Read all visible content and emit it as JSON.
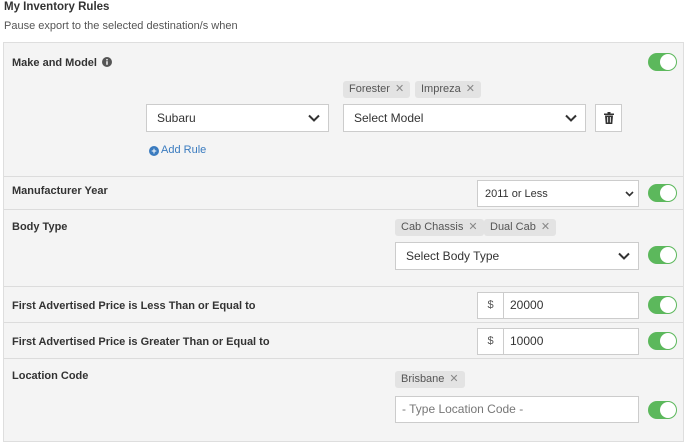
{
  "header": {
    "title": "My Inventory Rules",
    "subtitle": "Pause export to the selected destination/s when"
  },
  "rules": {
    "make_model": {
      "label": "Make and Model",
      "enabled": true,
      "make_value": "Subaru",
      "model_placeholder": "Select Model",
      "model_tags": [
        "Forester",
        "Impreza"
      ],
      "add_rule_label": "Add Rule"
    },
    "manufacturer_year": {
      "label": "Manufacturer Year",
      "enabled": true,
      "value": "2011 or Less"
    },
    "body_type": {
      "label": "Body Type",
      "enabled": true,
      "placeholder": "Select Body Type",
      "tags": [
        "Cab Chassis",
        "Dual Cab"
      ]
    },
    "price_max": {
      "label": "First Advertised Price is Less Than or Equal to",
      "enabled": true,
      "currency": "$",
      "value": "20000"
    },
    "price_min": {
      "label": "First Advertised Price is Greater Than or Equal to",
      "enabled": true,
      "currency": "$",
      "value": "10000"
    },
    "location_code": {
      "label": "Location Code",
      "enabled": true,
      "placeholder": "- Type Location Code -",
      "tags": [
        "Brisbane"
      ]
    }
  },
  "icons": {
    "info": "info-circle-icon",
    "chevron": "chevron-down-icon",
    "remove": "close-icon",
    "trash": "trash-icon",
    "plus": "plus-circle-icon"
  },
  "colors": {
    "toggle_on": "#5cb85c",
    "link": "#3a7bbf",
    "panel_bg": "#f4f4f4",
    "tag_bg": "#e3e3e3"
  }
}
